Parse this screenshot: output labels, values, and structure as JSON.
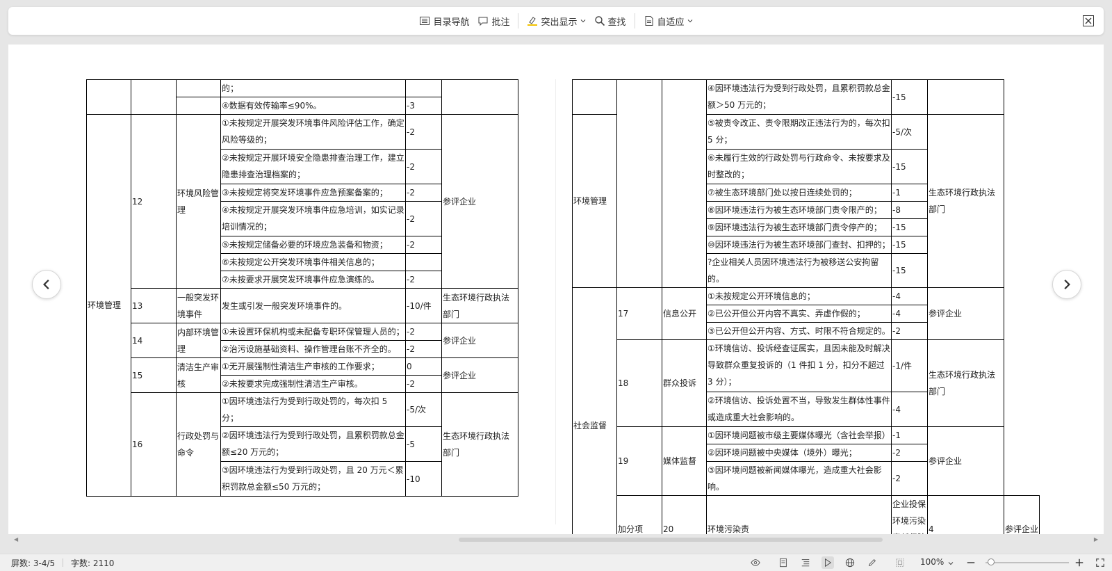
{
  "toolbar": {
    "toc_label": "目录导航",
    "annotate_label": "批注",
    "highlight_label": "突出显示",
    "find_label": "查找",
    "fit_label": "自适应"
  },
  "left_table": {
    "r1": {
      "content": "的；"
    },
    "r2": {
      "content": "④数据有效传输率≤90%。",
      "score": "-3"
    },
    "s12": {
      "no": "12",
      "name": "环境风险管理",
      "source": "参评企业",
      "items": [
        {
          "content": "①未按规定开展突发环境事件风险评估工作，确定风险等级的；",
          "score": "-2"
        },
        {
          "content": "②未按规定开展环境安全隐患排查治理工作，建立隐患排查治理档案的；",
          "score": "-2"
        },
        {
          "content": "③未按规定将突发环境事件应急预案备案的；",
          "score": "-2"
        },
        {
          "content": "④未按规定开展突发环境事件应急培训，如实记录培训情况的；",
          "score": "-2"
        },
        {
          "content": "⑤未按规定储备必要的环境应急装备和物资；",
          "score": "-2"
        },
        {
          "content": "⑥未按规定公开突发环境事件相关信息的；",
          "score": ""
        },
        {
          "content": "⑦未按要求开展突发环境事件应急演练的。",
          "score": "-2"
        }
      ]
    },
    "category": "环境管理",
    "s13": {
      "no": "13",
      "name": "一般突发环境事件",
      "content": "发生或引发一般突发环境事件的。",
      "score": "-10/件",
      "source": "生态环境行政执法部门"
    },
    "s14": {
      "no": "14",
      "name": "内部环境管理",
      "source": "参评企业",
      "items": [
        {
          "content": "①未设置环保机构或未配备专职环保管理人员的；",
          "score": "-2"
        },
        {
          "content": "②治污设施基础资料、操作管理台账不齐全的。",
          "score": "-2"
        }
      ]
    },
    "s15": {
      "no": "15",
      "name": "清洁生产审核",
      "source": "参评企业",
      "items": [
        {
          "content": "①无开展强制性清洁生产审核的工作要求；",
          "score": "0"
        },
        {
          "content": "②未按要求完成强制性清洁生产审核。",
          "score": "-2"
        }
      ]
    },
    "s16": {
      "no": "16",
      "name": "行政处罚与命令",
      "source": "生态环境行政执法部门",
      "items": [
        {
          "content": "①因环境违法行为受到行政处罚的，每次扣 5 分；",
          "score": "-5/次"
        },
        {
          "content": "②因环境违法行为受到行政处罚，且累积罚款总金额≤20 万元的；",
          "score": "-5"
        },
        {
          "content": "③因环境违法行为受到行政处罚，且 20 万元＜累积罚款总金额≤50 万元的；",
          "score": "-10"
        }
      ]
    }
  },
  "right_table": {
    "r1": {
      "content": "④因环境违法行为受到行政处罚，且累积罚款总金额＞50 万元的；",
      "score": "-15"
    },
    "cat_env": "环境管理",
    "source_cont": "生态环境行政执法部门",
    "cont": [
      {
        "content": "⑤被责令改正、责令限期改正违法行为的，每次扣 5 分；",
        "score": "-5/次"
      },
      {
        "content": "⑥未履行生效的行政处罚与行政命令、未按要求及时整改的；",
        "score": "-15"
      },
      {
        "content": "⑦被生态环境部门处以按日连续处罚的；",
        "score": "-1"
      },
      {
        "content": "⑧因环境违法行为被生态环境部门责令限产的；",
        "score": "-8"
      },
      {
        "content": "⑨因环境违法行为被生态环境部门责令停产的；",
        "score": "-15"
      },
      {
        "content": "⑩因环境违法行为被生态环境部门查封、扣押的；",
        "score": "-15"
      },
      {
        "content": "?企业相关人员因环境违法行为被移送公安拘留的。",
        "score": "-15"
      }
    ],
    "cat_social": "社会监督",
    "s17": {
      "no": "17",
      "name": "信息公开",
      "source": "参评企业",
      "items": [
        {
          "content": "①未按规定公开环境信息的；",
          "score": "-4"
        },
        {
          "content": "②已公开但公开内容不真实、弄虚作假的；",
          "score": "-4"
        },
        {
          "content": "③已公开但公开内容、方式、时限不符合规定的。",
          "score": "-2"
        }
      ]
    },
    "s18": {
      "no": "18",
      "name": "群众投诉",
      "source": "生态环境行政执法部门",
      "items": [
        {
          "content": "①环境信访、投诉经查证属实，且因未能及时解决导致群众重复投诉的（1 件扣 1 分，扣分不超过 3 分）；",
          "score": "-1/件"
        },
        {
          "content": "②环境信访、投诉处置不当，导致发生群体性事件或造成重大社会影响的。",
          "score": "-4"
        }
      ]
    },
    "s19": {
      "no": "19",
      "name": "媒体监督",
      "source": "参评企业",
      "items": [
        {
          "content": "①因环境问题被市级主要媒体曝光（含社会举报）",
          "score": "-1"
        },
        {
          "content": "②因环境问题被中央媒体（境外）曝光；",
          "score": "-2"
        },
        {
          "content": "③因环境问题被新闻媒体曝光，造成重大社会影响。",
          "score": "-2"
        }
      ]
    },
    "s20": {
      "category": "加分项",
      "no": "20",
      "name": "环境污染责",
      "content": "企业投保环境污染责任保险的；",
      "score": "4",
      "source": "参评企业"
    }
  },
  "status": {
    "screens": "屏数: 3-4/5",
    "words": "字数: 2110",
    "zoom": "100%",
    "zoom_level": 0.5
  }
}
